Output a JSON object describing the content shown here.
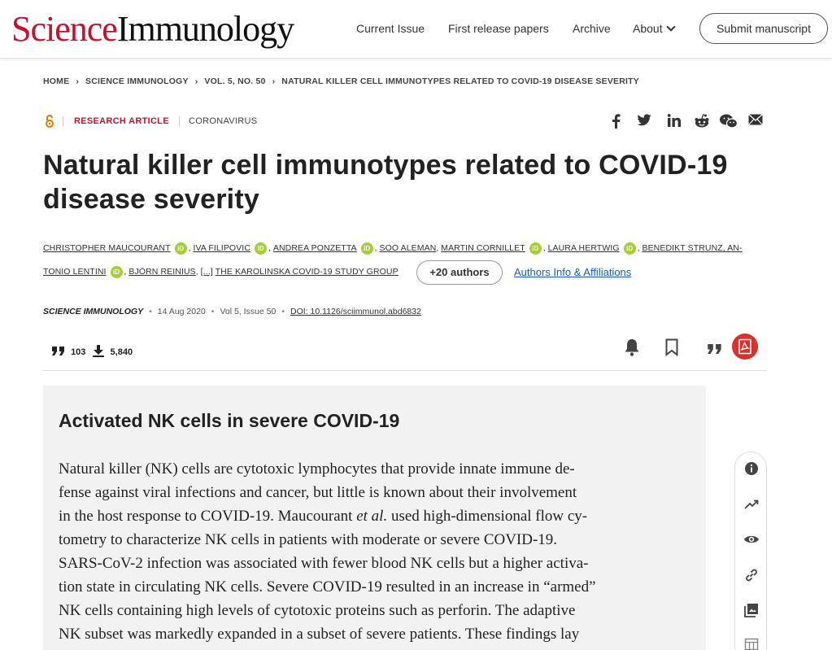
{
  "header": {
    "logo_part1": "Science",
    "logo_part2": "Immunology",
    "nav": [
      {
        "label": "Current Issue"
      },
      {
        "label": "First release papers"
      },
      {
        "label": "Archive"
      },
      {
        "label": "About"
      }
    ],
    "submit_label": "Submit manuscript"
  },
  "breadcrumb": [
    "HOME",
    "SCIENCE IMMUNOLOGY",
    "VOL. 5, NO. 50",
    "NATURAL KILLER CELL IMMUNOTYPES RELATED TO COVID-19 DISEASE SEVERITY"
  ],
  "article_type": {
    "open_access_icon": "open-access-icon",
    "type": "RESEARCH ARTICLE",
    "topic": "CORONAVIRUS"
  },
  "share_icons": [
    "facebook-icon",
    "twitter-icon",
    "linkedin-icon",
    "reddit-icon",
    "wechat-icon",
    "email-icon"
  ],
  "title_line1": "Natural killer cell immunotypes related to COVID-19",
  "title_line2": "disease severity",
  "authors": {
    "a1": "CHRISTOPHER MAUCOURANT",
    "a2": "IVA FILIPOVIC",
    "a3": "ANDREA PONZETTA",
    "a4": "SOO ALEMAN",
    "a5": "MARTIN CORNILLET",
    "a6": "LAURA HERTWIG",
    "a7a": "BENEDIKT STRUNZ, AN-",
    "a7b": "TONIO LENTINI",
    "a8": "BJÖRN REINIUS",
    "ellipsis": "[...]",
    "a9": "THE KAROLINSKA COVID-19 STUDY GROUP",
    "more": "+20 authors",
    "affiliations": "Authors Info & Affiliations",
    "orcid_label": "iD"
  },
  "meta": {
    "journal": "SCIENCE IMMUNOLOGY",
    "date": "14 Aug 2020",
    "volume": "Vol 5, Issue 50",
    "doi": "DOI: 10.1126/sciimmunol.abd6832"
  },
  "metrics": {
    "citations": "103",
    "downloads": "5,840"
  },
  "summary": {
    "heading": "Activated NK cells in severe COVID-19",
    "lines": [
      "Natural killer (NK) cells are cytotoxic lymphocytes that provide innate immune de-",
      "fense against viral infections and cancer, but little is known about their involvement",
      "in the host response to COVID-19. Maucourant ",
      "et al.",
      " used high-dimensional flow cy-",
      "tometry to characterize NK cells in patients with moderate or severe COVID-19.",
      "SARS-CoV-2 infection was associated with fewer blood NK cells but a higher activa-",
      "tion state in circulating NK cells. Severe COVID-19 resulted in an increase in “armed”",
      "NK cells containing high levels of cytotoxic proteins such as perforin. The adaptive",
      "NK subset was markedly expanded in a subset of severe patients. These findings lay"
    ]
  },
  "colors": {
    "brand_red": "#c8102e",
    "orcid_green": "#a6ce39",
    "pdf_red": "#d9322b",
    "link_blue": "#1a5fb4"
  }
}
